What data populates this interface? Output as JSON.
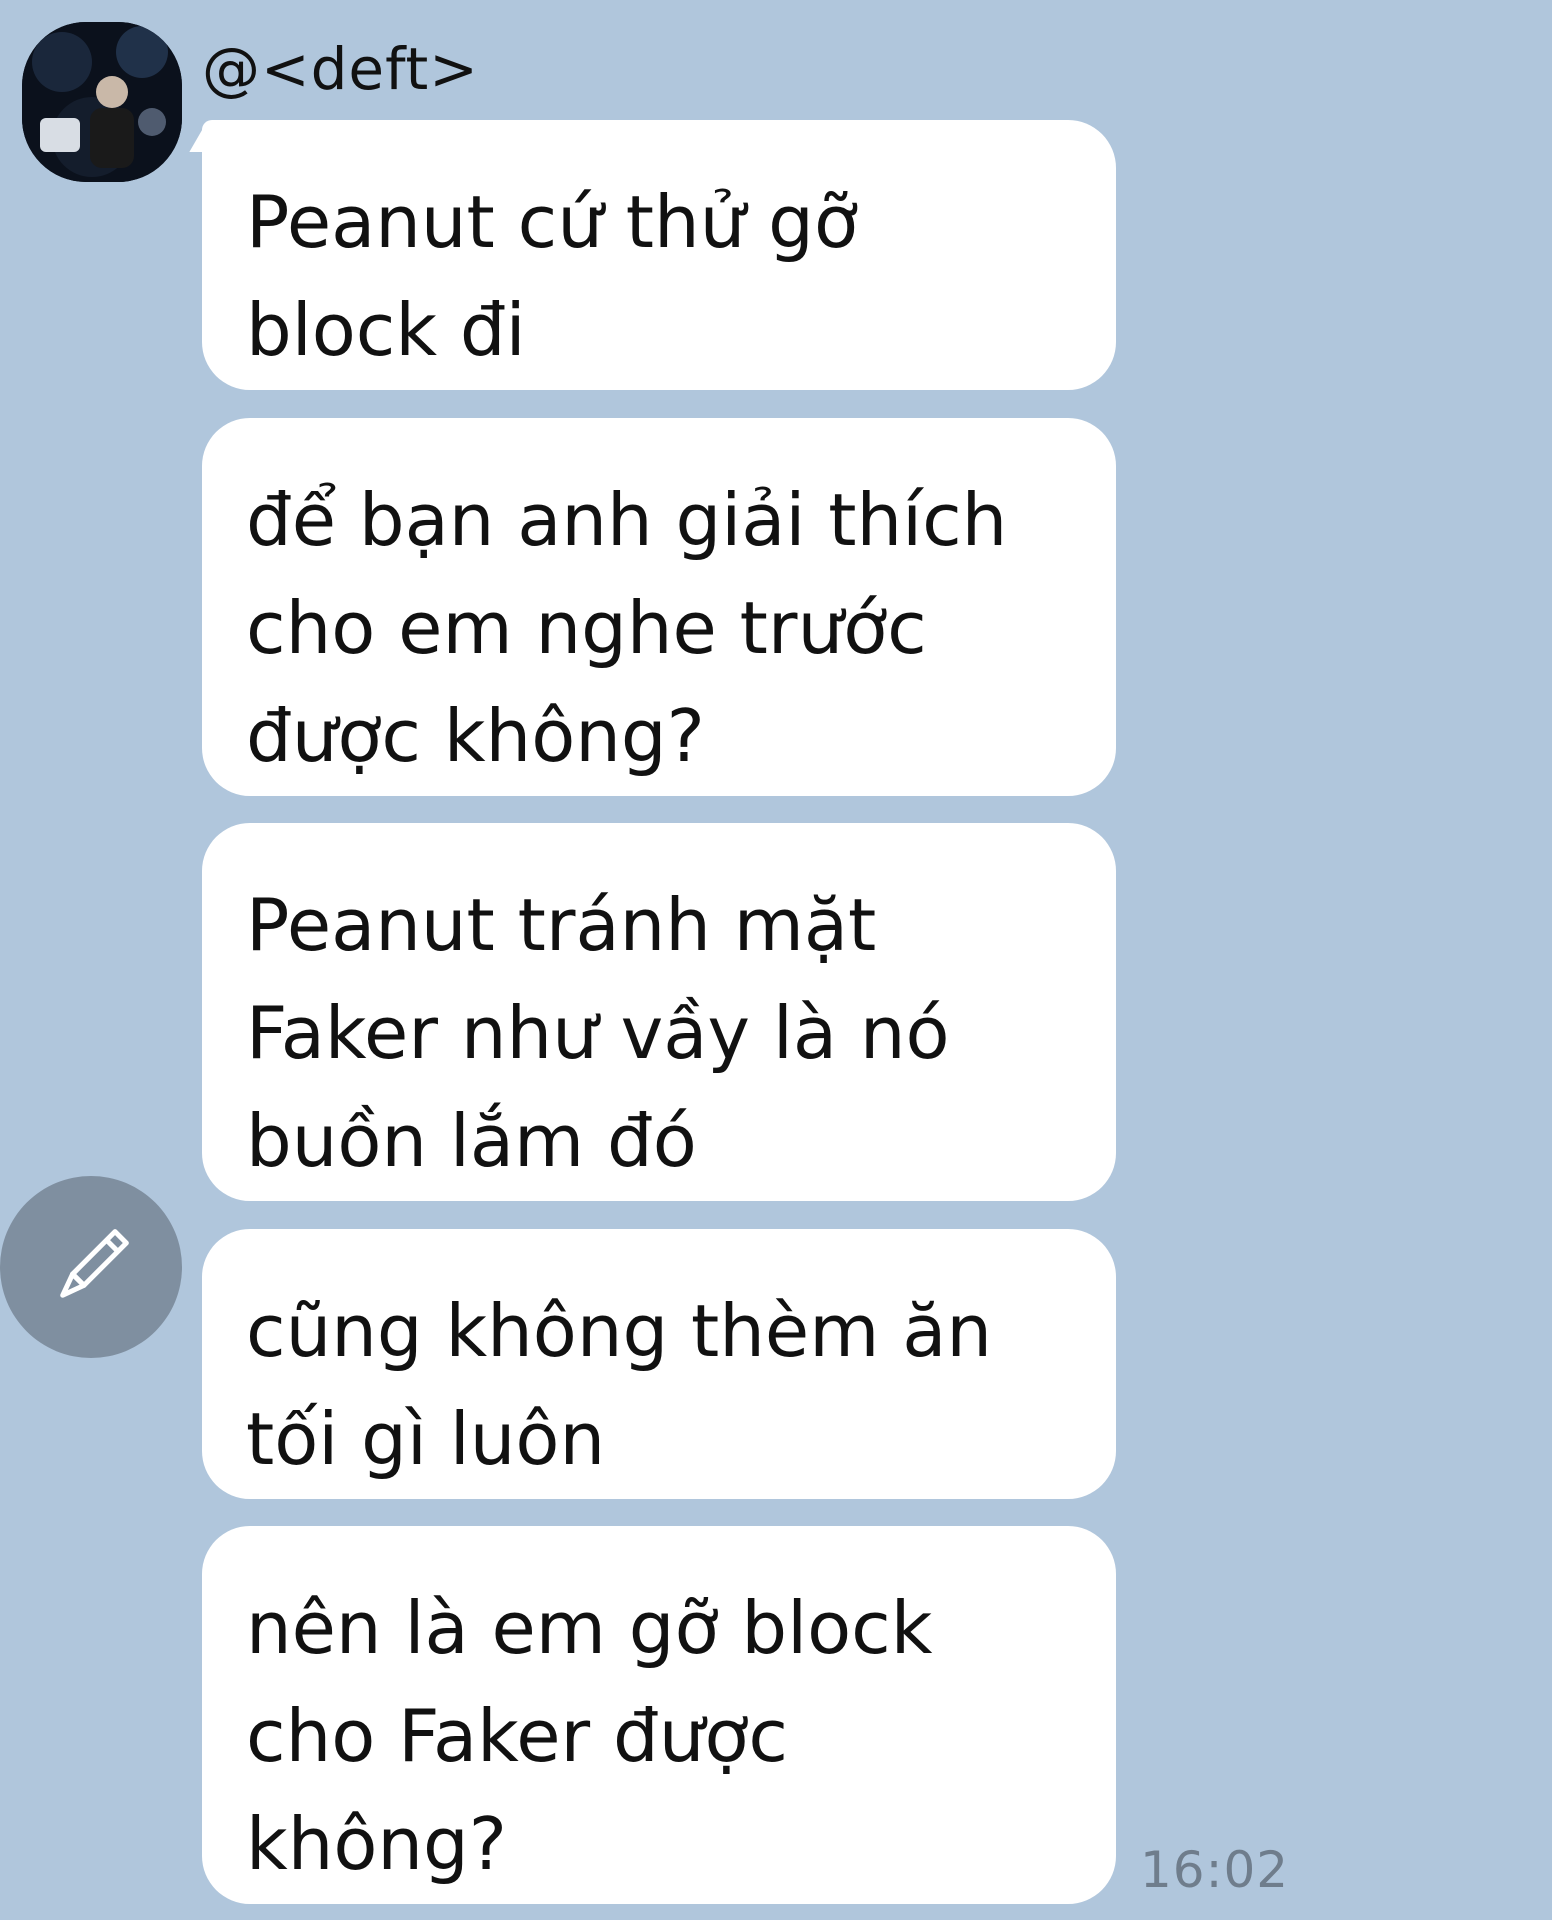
{
  "chat": {
    "sender_name": "@<deft>",
    "timestamp": "16:02",
    "messages": [
      {
        "text": "Peanut cứ thử gỡ\nblock đi"
      },
      {
        "text": "để bạn anh giải thích\ncho em nghe trước\nđược không?"
      },
      {
        "text": "Peanut tránh mặt\nFaker như vầy là nó\nbuồn lắm đó"
      },
      {
        "text": "cũng không thèm ăn\ntối gì luôn"
      },
      {
        "text": "nên là em gỡ block\ncho Faker được\nkhông?"
      }
    ]
  },
  "icons": {
    "avatar": "user-avatar",
    "edit": "pencil-icon"
  },
  "colors": {
    "background": "#b0c6dc",
    "bubble": "#ffffff",
    "fab": "#7f8fa0",
    "timestamp": "#6f7d8c"
  }
}
